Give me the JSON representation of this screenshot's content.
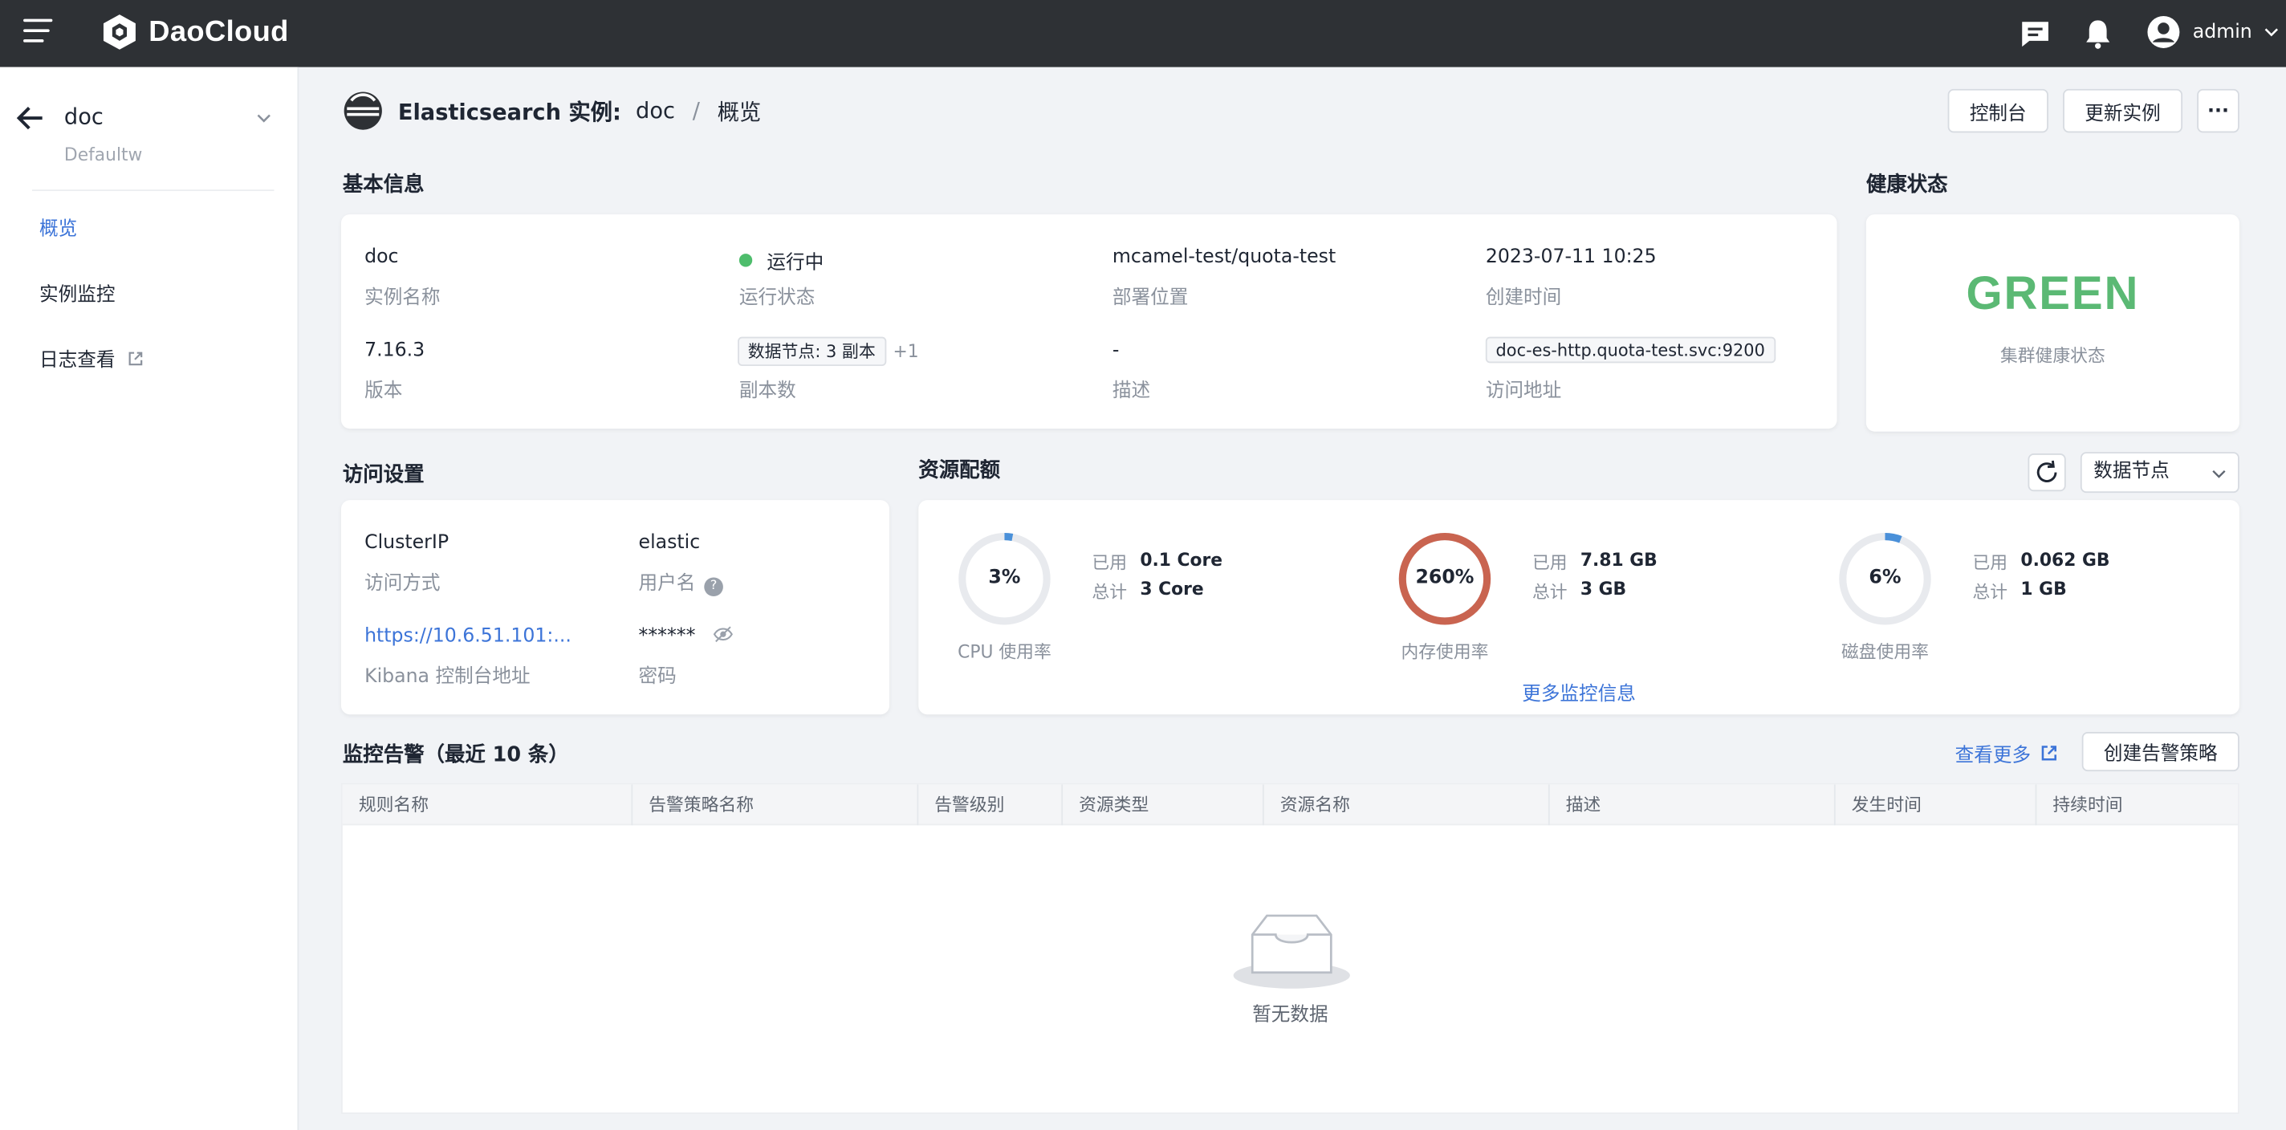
{
  "topbar": {
    "brand": "DaoCloud",
    "user": "admin",
    "icons": [
      "menu-icon",
      "message-icon",
      "bell-icon",
      "user-avatar-icon",
      "chevron-down-icon"
    ]
  },
  "sidebar": {
    "instance_name": "doc",
    "workspace": "Defaultw",
    "items": [
      {
        "label": "概览",
        "active": true
      },
      {
        "label": "实例监控",
        "active": false
      },
      {
        "label": "日志查看",
        "active": false,
        "external": true
      }
    ]
  },
  "breadcrumb": {
    "product": "Elasticsearch 实例:",
    "instance": "doc",
    "separator": "/",
    "page": "概览"
  },
  "actions": {
    "console": "控制台",
    "update": "更新实例",
    "more": "···"
  },
  "basic_info": {
    "title": "基本信息",
    "name_value": "doc",
    "name_label": "实例名称",
    "status_value": "运行中",
    "status_label": "运行状态",
    "location_value": "mcamel-test/quota-test",
    "location_label": "部署位置",
    "created_value": "2023-07-11 10:25",
    "created_label": "创建时间",
    "version_value": "7.16.3",
    "version_label": "版本",
    "replicas_tag": "数据节点: 3 副本",
    "replicas_more": "+1",
    "replicas_label": "副本数",
    "desc_value": "-",
    "desc_label": "描述",
    "address_value": "doc-es-http.quota-test.svc:9200",
    "address_label": "访问地址",
    "status_color": "#4ebd6c"
  },
  "health": {
    "title": "健康状态",
    "value": "GREEN",
    "label": "集群健康状态",
    "color": "#5bb974"
  },
  "access": {
    "title": "访问设置",
    "method_value": "ClusterIP",
    "method_label": "访问方式",
    "user_value": "elastic",
    "user_label": "用户名",
    "kibana_value": "https://10.6.51.101:...",
    "kibana_label": "Kibana 控制台地址",
    "password_value": "******",
    "password_label": "密码"
  },
  "resources": {
    "title": "资源配额",
    "node_select": "数据节点",
    "more_link": "更多监控信息",
    "used_label": "已用",
    "total_label": "总计",
    "gauges": [
      {
        "pct_text": "3%",
        "pct": 3,
        "label": "CPU 使用率",
        "used": "0.1 Core",
        "total": "3 Core",
        "color": "#4a90d9"
      },
      {
        "pct_text": "260%",
        "pct": 100,
        "label": "内存使用率",
        "used": "7.81 GB",
        "total": "3 GB",
        "color": "#c96450"
      },
      {
        "pct_text": "6%",
        "pct": 6,
        "label": "磁盘使用率",
        "used": "0.062 GB",
        "total": "1 GB",
        "color": "#4a90d9"
      }
    ]
  },
  "alerts": {
    "title": "监控告警（最近 10 条）",
    "view_more": "查看更多",
    "create": "创建告警策略",
    "columns": [
      "规则名称",
      "告警策略名称",
      "告警级别",
      "资源类型",
      "资源名称",
      "描述",
      "发生时间",
      "持续时间"
    ],
    "empty": "暂无数据"
  }
}
